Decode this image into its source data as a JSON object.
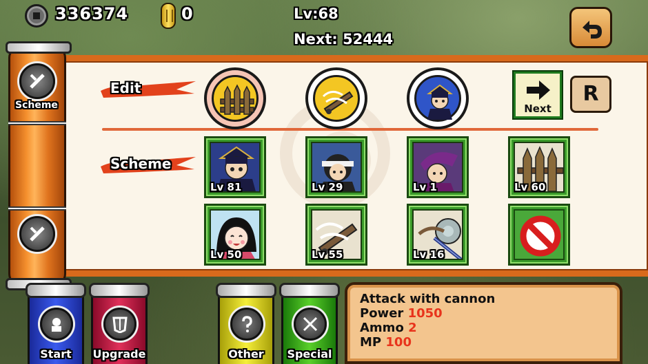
{
  "header": {
    "coins": "336374",
    "gold": "0",
    "level": "Lv:68",
    "next": "Next: 52444"
  },
  "sidebar": {
    "scheme_label": "Scheme"
  },
  "sections": {
    "edit_label": "Edit",
    "scheme_label": "Scheme"
  },
  "edit_slots": [
    "fence",
    "cannon",
    "samurai"
  ],
  "buttons": {
    "next_label": "Next",
    "r_label": "R"
  },
  "cards": [
    {
      "unit": "samurai",
      "level": "Lv 81"
    },
    {
      "unit": "ninja",
      "level": "Lv 29"
    },
    {
      "unit": "kunoichi",
      "level": "Lv 1"
    },
    {
      "unit": "fence",
      "level": "Lv 60"
    },
    {
      "unit": "princess",
      "level": "Lv 50"
    },
    {
      "unit": "cannon",
      "level": "Lv 55"
    },
    {
      "unit": "spear-shield",
      "level": "Lv 16"
    },
    {
      "unit": "empty",
      "level": ""
    }
  ],
  "bottom_tabs": [
    {
      "label": "Start",
      "color": "#2a3fd8"
    },
    {
      "label": "Upgrade",
      "color": "#c01a4a"
    },
    {
      "label": "Other",
      "color": "#d8d21a"
    },
    {
      "label": "Special",
      "color": "#3aa81a"
    }
  ],
  "info": {
    "title": "Attack with cannon",
    "power_label": "Power",
    "power_value": "1050",
    "ammo_label": "Ammo",
    "ammo_value": "2",
    "mp_label": "MP",
    "mp_value": "100"
  }
}
